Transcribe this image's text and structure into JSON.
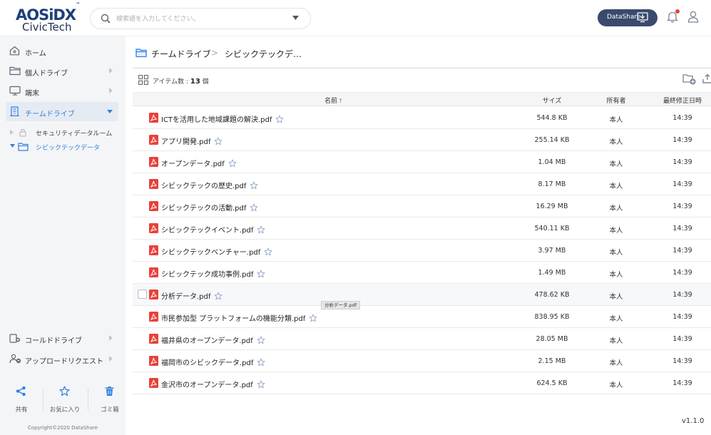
{
  "header": {
    "logo_top": "AOSiDX",
    "logo_tm": "™",
    "logo_bottom": "CivicTech",
    "search_placeholder": "検索語を入力してください。",
    "datashare_label": "DataShare"
  },
  "sidebar": {
    "items": [
      {
        "label": "ホーム",
        "icon": "home-icon"
      },
      {
        "label": "個人ドライブ",
        "icon": "folder-icon"
      },
      {
        "label": "端末",
        "icon": "monitor-icon"
      },
      {
        "label": "チームドライブ",
        "icon": "building-icon"
      }
    ],
    "sub_items": [
      {
        "label": "セキュリティデータルーム",
        "icon": "locked-folder-icon"
      },
      {
        "label": "シビックテックデータ",
        "icon": "folder-icon"
      }
    ],
    "bottom_items": [
      {
        "label": "コールドドライブ",
        "icon": "cold-drive-icon"
      },
      {
        "label": "アップロードリクエスト",
        "icon": "upload-request-icon"
      }
    ],
    "actions": [
      {
        "label": "共有",
        "icon": "share-icon"
      },
      {
        "label": "お気に入り",
        "icon": "star-icon"
      },
      {
        "label": "ゴミ箱",
        "icon": "trash-icon"
      }
    ],
    "copyright": "Copyright©2020 DataShare"
  },
  "main": {
    "breadcrumb": [
      "チームドライブ",
      "シビックテックデ…"
    ],
    "breadcrumb_sep": ">",
    "count_label": "アイテム数 : ",
    "count_value": "13",
    "count_unit": " 個",
    "columns": {
      "name": "名前",
      "sort": "↑",
      "size": "サイズ",
      "owner": "所有者",
      "modified": "最終修正日時"
    },
    "files": [
      {
        "name": "ICTを活用した地域課題の解決.pdf",
        "size": "544.8 KB",
        "owner": "本人",
        "modified": "14:39"
      },
      {
        "name": "アプリ開発.pdf",
        "size": "255.14 KB",
        "owner": "本人",
        "modified": "14:39"
      },
      {
        "name": "オープンデータ.pdf",
        "size": "1.04 MB",
        "owner": "本人",
        "modified": "14:39"
      },
      {
        "name": "シビックテックの歴史.pdf",
        "size": "8.17 MB",
        "owner": "本人",
        "modified": "14:39"
      },
      {
        "name": "シビックテックの活動.pdf",
        "size": "16.29 MB",
        "owner": "本人",
        "modified": "14:39"
      },
      {
        "name": "シビックテックイベント.pdf",
        "size": "540.11 KB",
        "owner": "本人",
        "modified": "14:39"
      },
      {
        "name": "シビックテックベンチャー.pdf",
        "size": "3.97 MB",
        "owner": "本人",
        "modified": "14:39"
      },
      {
        "name": "シビックテック成功事例.pdf",
        "size": "1.49 MB",
        "owner": "本人",
        "modified": "14:39"
      },
      {
        "name": "分析データ.pdf",
        "size": "478.62 KB",
        "owner": "本人",
        "modified": "14:39"
      },
      {
        "name": "市民参加型 プラットフォームの機能分類.pdf",
        "size": "838.95 KB",
        "owner": "本人",
        "modified": "14:39"
      },
      {
        "name": "福井県のオープンデータ.pdf",
        "size": "28.05 MB",
        "owner": "本人",
        "modified": "14:39"
      },
      {
        "name": "福岡市のシビックデータ.pdf",
        "size": "2.15 MB",
        "owner": "本人",
        "modified": "14:39"
      },
      {
        "name": "金沢市のオープンデータ.pdf",
        "size": "624.5 KB",
        "owner": "本人",
        "modified": "14:39"
      }
    ],
    "tooltip": "分析データ.pdf",
    "version": "v1.1.0"
  },
  "colors": {
    "accent": "#2f7fe0",
    "brand": "#1d3f7a",
    "pdf": "#e8413a",
    "button_bg": "#3a4a6e",
    "sidebar_bg": "#f4f5f7"
  }
}
